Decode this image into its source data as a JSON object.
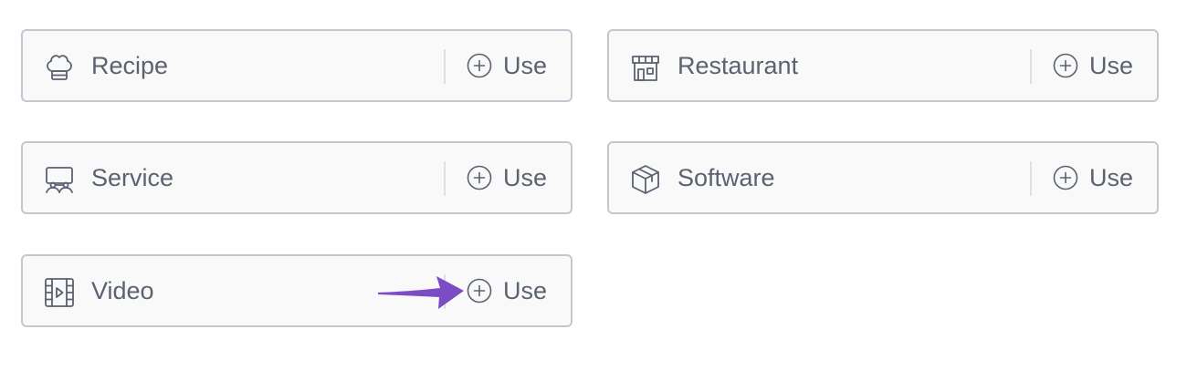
{
  "schema_types": [
    {
      "label": "Recipe",
      "icon": "chef-hat-icon",
      "action": "Use"
    },
    {
      "label": "Restaurant",
      "icon": "storefront-icon",
      "action": "Use"
    },
    {
      "label": "Service",
      "icon": "service-counter-icon",
      "action": "Use"
    },
    {
      "label": "Software",
      "icon": "package-box-icon",
      "action": "Use"
    },
    {
      "label": "Video",
      "icon": "film-strip-icon",
      "action": "Use"
    }
  ],
  "colors": {
    "card_background": "#f9f9f9",
    "card_border": "#c3c8d0",
    "text": "#5b6270",
    "annotation_arrow": "#7b4cc4"
  }
}
